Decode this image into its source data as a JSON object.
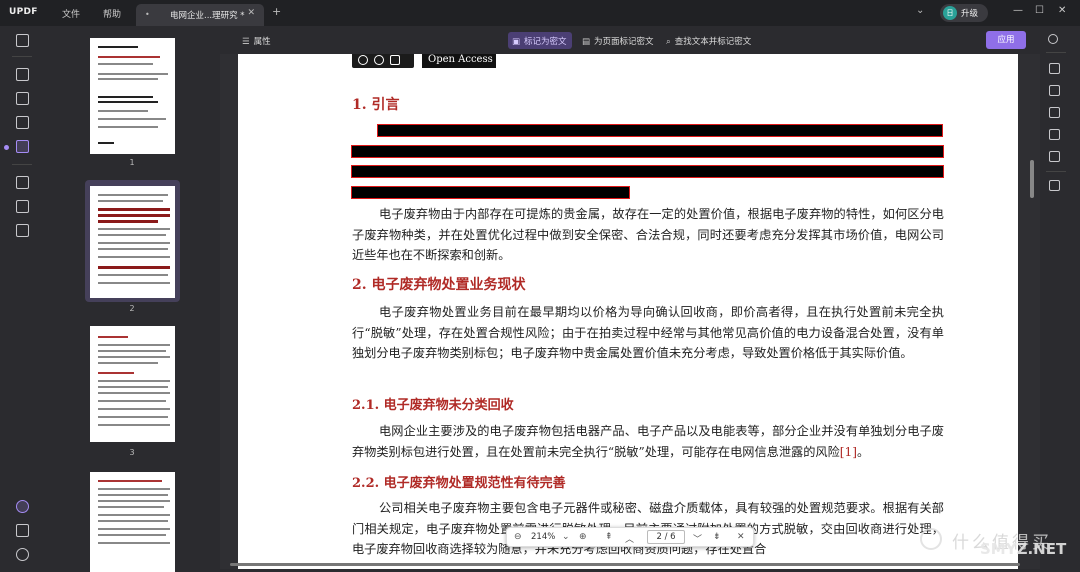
{
  "titlebar": {
    "logo": "UPDF",
    "menu": [
      "文件",
      "帮助"
    ],
    "tab_title": "电网企业...理研究 *",
    "upgrade_avatar": "日",
    "upgrade_label": "升级"
  },
  "toolbar": {
    "properties": "属性",
    "mark_redact": "标记为密文",
    "mark_page": "为页面标记密文",
    "find_mark": "查找文本并标记密文",
    "apply": "应用"
  },
  "thumbnails": {
    "page_numbers": [
      "1",
      "2",
      "3"
    ]
  },
  "document": {
    "badge_text": "Open Access",
    "h1_intro": "1. 引言",
    "para_1": "电子废弃物由于内部存在可提炼的贵金属，故存在一定的处置价值，根据电子废弃物的特性，如何区分电子废弃物种类，并在处置优化过程中做到安全保密、合法合规，同时还要考虑充分发挥其市场价值，电网公司近些年也在不断探索和创新。",
    "h1_business": "2. 电子废弃物处置业务现状",
    "para_2": "电子废弃物处置业务目前在最早期均以价格为导向确认回收商，即价高者得，且在执行处置前未完全执行“脱敏”处理，存在处置合规性风险；由于在拍卖过程中经常与其他常见高价值的电力设备混合处置，没有单独划分电子废弃物类别标包；电子废弃物中贵金属处置价值未充分考虑，导致处置价格低于其实际价值。",
    "h2_unclassified": "2.1. 电子废弃物未分类回收",
    "para_3": "电网企业主要涉及的电子废弃物包括电器产品、电子产品以及电能表等，部分企业并没有单独划分电子废弃物类别标包进行处置，且在处置前未完全执行“脱敏”处理，可能存在电网信息泄露的风险",
    "para_3_ref": "[1]",
    "para_3_end": "。",
    "h2_normative": "2.2. 电子废弃物处置规范性有待完善",
    "para_4": "公司相关电子废弃物主要包含电子元器件或秘密、磁盘介质载体，具有较强的处置规范要求。根据有关部门相关规定，电子废弃物处置前需进行脱敏处理，目前主要通过附加处置的方式脱敏，交由回收商进行处理，电子废弃物回收商选择较为随意，并未充分考虑回收商资质问题，存在处置合"
  },
  "zoom_bar": {
    "zoom": "214%",
    "page_indicator": "2 / 6"
  },
  "watermark": {
    "text_cn": "什么值得买",
    "text_en": "SMYZ.NET"
  },
  "colors": {
    "accent": "#8f6fe8",
    "heading_red": "#b02a26",
    "redact_border": "#e01818"
  }
}
